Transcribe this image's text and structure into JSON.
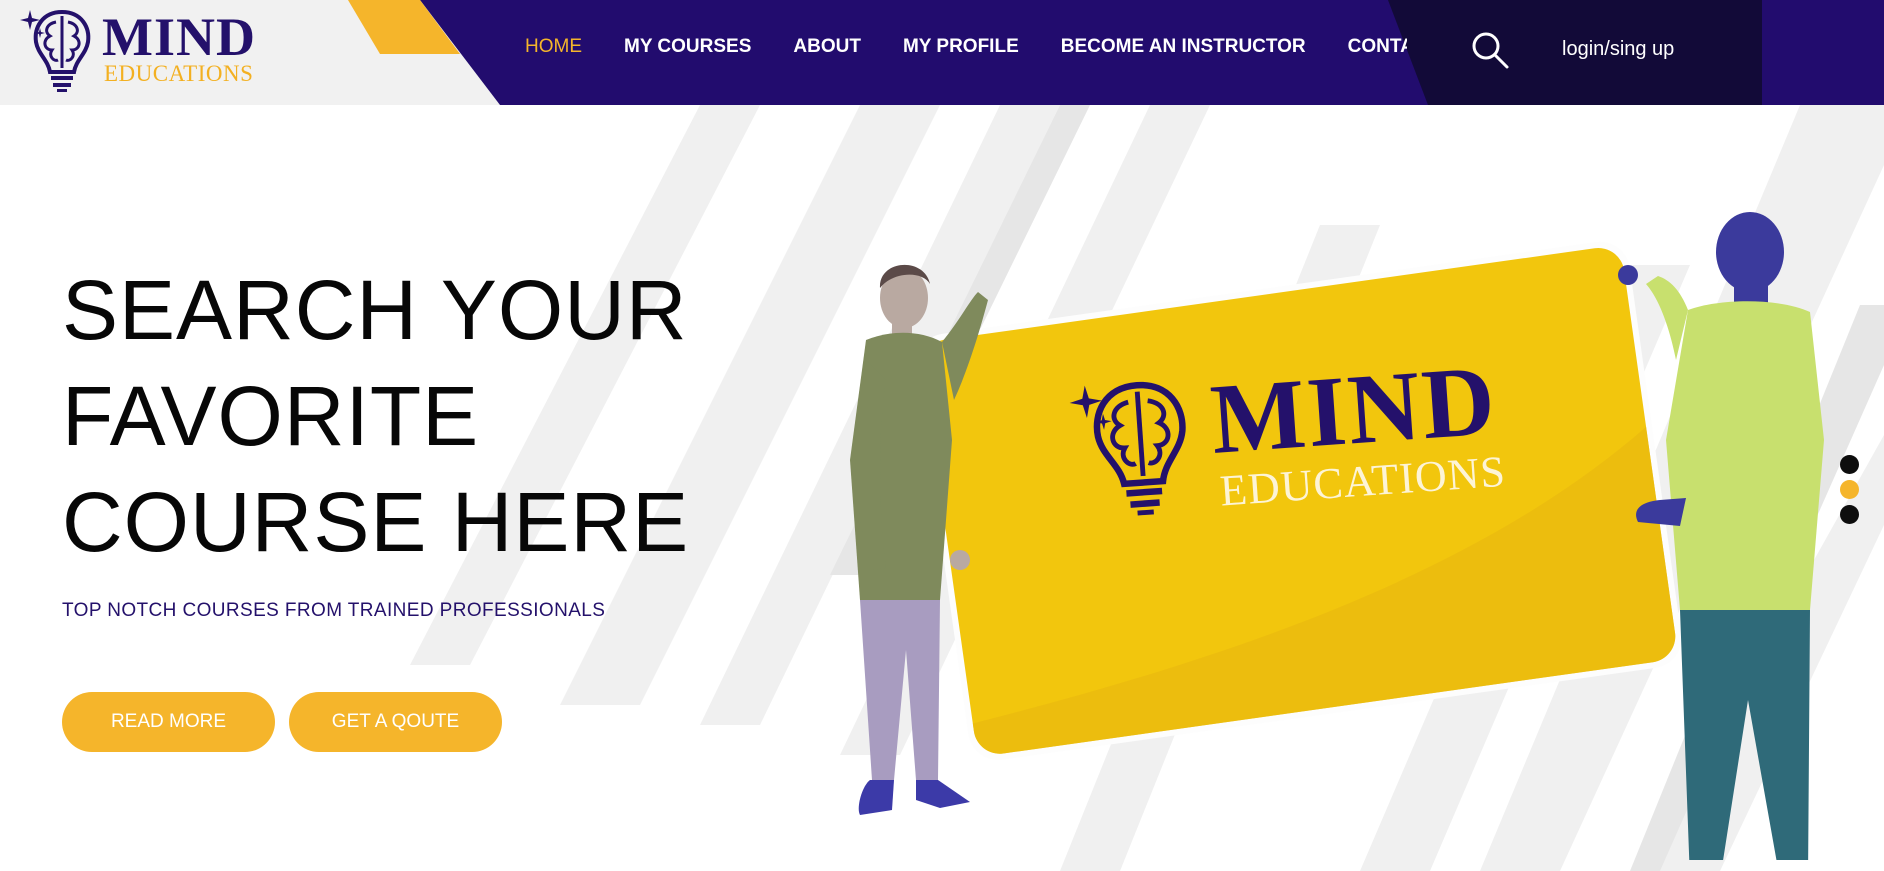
{
  "brand": {
    "name_top": "MIND",
    "name_bottom": "EDUCATIONS",
    "primary_color": "#24116b",
    "accent_color": "#f5b52b",
    "dark_color": "#120a38"
  },
  "nav": {
    "items": [
      {
        "label": "HOME",
        "active": true
      },
      {
        "label": "MY COURSES",
        "active": false
      },
      {
        "label": "ABOUT",
        "active": false
      },
      {
        "label": "MY PROFILE",
        "active": false
      },
      {
        "label": "BECOME AN INSTRUCTOR",
        "active": false
      },
      {
        "label": "CONTACT",
        "active": false
      }
    ],
    "search_icon": "search-icon",
    "login_label": "login/sing up"
  },
  "hero": {
    "headline": [
      "SEARCH YOUR",
      "FAVORITE",
      "COURSE HERE"
    ],
    "subtitle": "TOP NOTCH COURSES FROM TRAINED PROFESSIONALS",
    "buttons": {
      "read_more": "READ MORE",
      "get_quote": "GET A QOUTE"
    },
    "card": {
      "name_top": "MIND",
      "name_bottom": "EDUCATIONS"
    },
    "slider": {
      "count": 3,
      "active_index": 1
    }
  }
}
